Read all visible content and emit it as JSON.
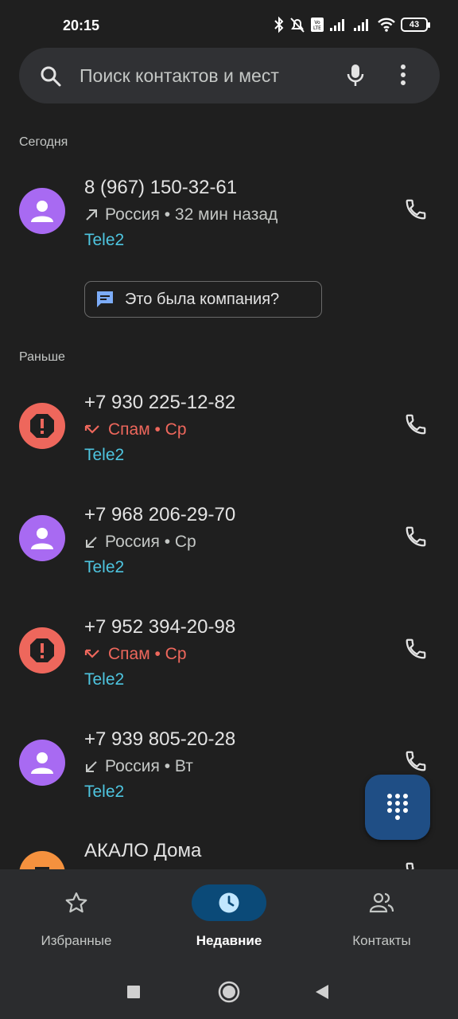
{
  "status": {
    "time": "20:15",
    "battery": "43"
  },
  "search": {
    "placeholder": "Поиск контактов и мест"
  },
  "sections": {
    "today": "Сегодня",
    "earlier": "Раньше"
  },
  "calls": [
    {
      "number": "8 (967) 150-32-61",
      "direction": "outgoing",
      "detail": "Россия • 32 мин назад",
      "carrier": "Tele2",
      "avatar": "person",
      "color": "#a86af2"
    },
    {
      "number": "+7 930 225-12-82",
      "direction": "missed",
      "detail": "Спам • Ср",
      "carrier": "Tele2",
      "avatar": "spam",
      "color": "#ee675c"
    },
    {
      "number": "+7 968 206-29-70",
      "direction": "incoming",
      "detail": "Россия • Ср",
      "carrier": "Tele2",
      "avatar": "person",
      "color": "#a86af2"
    },
    {
      "number": "+7 952 394-20-98",
      "direction": "missed",
      "detail": "Спам • Ср",
      "carrier": "Tele2",
      "avatar": "spam",
      "color": "#ee675c"
    },
    {
      "number": "+7 939 805-20-28",
      "direction": "incoming",
      "detail": "Россия • Вт",
      "carrier": "Tele2",
      "avatar": "person",
      "color": "#a86af2"
    },
    {
      "number": "АКАЛО Дома",
      "avatar": "business",
      "color": "#f5913e"
    }
  ],
  "company_chip": {
    "label": "Это была компания?"
  },
  "nav": {
    "favorites": "Избранные",
    "recents": "Недавние",
    "contacts": "Контакты"
  },
  "colors": {
    "accent": "#0b4a78",
    "carrier": "#4ec5e0",
    "spam": "#ee675c"
  }
}
